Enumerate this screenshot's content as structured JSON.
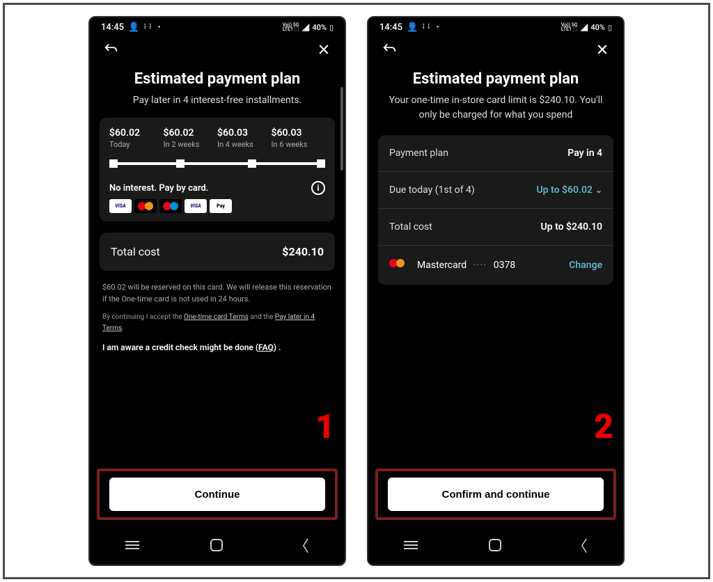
{
  "status": {
    "time": "14:45",
    "battery": "40%",
    "network_label": "Vo) 5G",
    "lite_label": "LTE1"
  },
  "screen1": {
    "title": "Estimated payment plan",
    "subtitle": "Pay later in 4 interest-free installments.",
    "installments": [
      {
        "amount": "$60.02",
        "label": "Today"
      },
      {
        "amount": "$60.02",
        "label": "In 2 weeks"
      },
      {
        "amount": "$60.03",
        "label": "In 4 weeks"
      },
      {
        "amount": "$60.03",
        "label": "In 6 weeks"
      }
    ],
    "no_interest": "No interest. Pay by card.",
    "total_label": "Total cost",
    "total_value": "$240.10",
    "disclaimer": "$60.02 will be reserved on this card. We will release this reservation if the One-time card is not used in 24 hours.",
    "terms_prefix": "By continuing I accept the ",
    "terms_link1": "One-time card Terms",
    "terms_mid": " and the ",
    "terms_link2": "Pay later in 4 Terms",
    "terms_suffix": ".",
    "aware_prefix": "I am aware a credit check might be done (",
    "aware_link": "FAQ",
    "aware_suffix": ") .",
    "cta": "Continue",
    "step": "1"
  },
  "screen2": {
    "title": "Estimated payment plan",
    "subtitle": "Your one-time in-store card limit is $240.10. You'll only be charged for what you spend",
    "rows": {
      "plan_label": "Payment plan",
      "plan_value": "Pay in 4",
      "due_label": "Due today (1st of 4)",
      "due_value": "Up to $60.02",
      "total_label": "Total cost",
      "total_value": "Up to $240.10",
      "pm_name": "Mastercard",
      "pm_last4": "0378",
      "pm_change": "Change"
    },
    "cta": "Confirm and continue",
    "step": "2"
  }
}
